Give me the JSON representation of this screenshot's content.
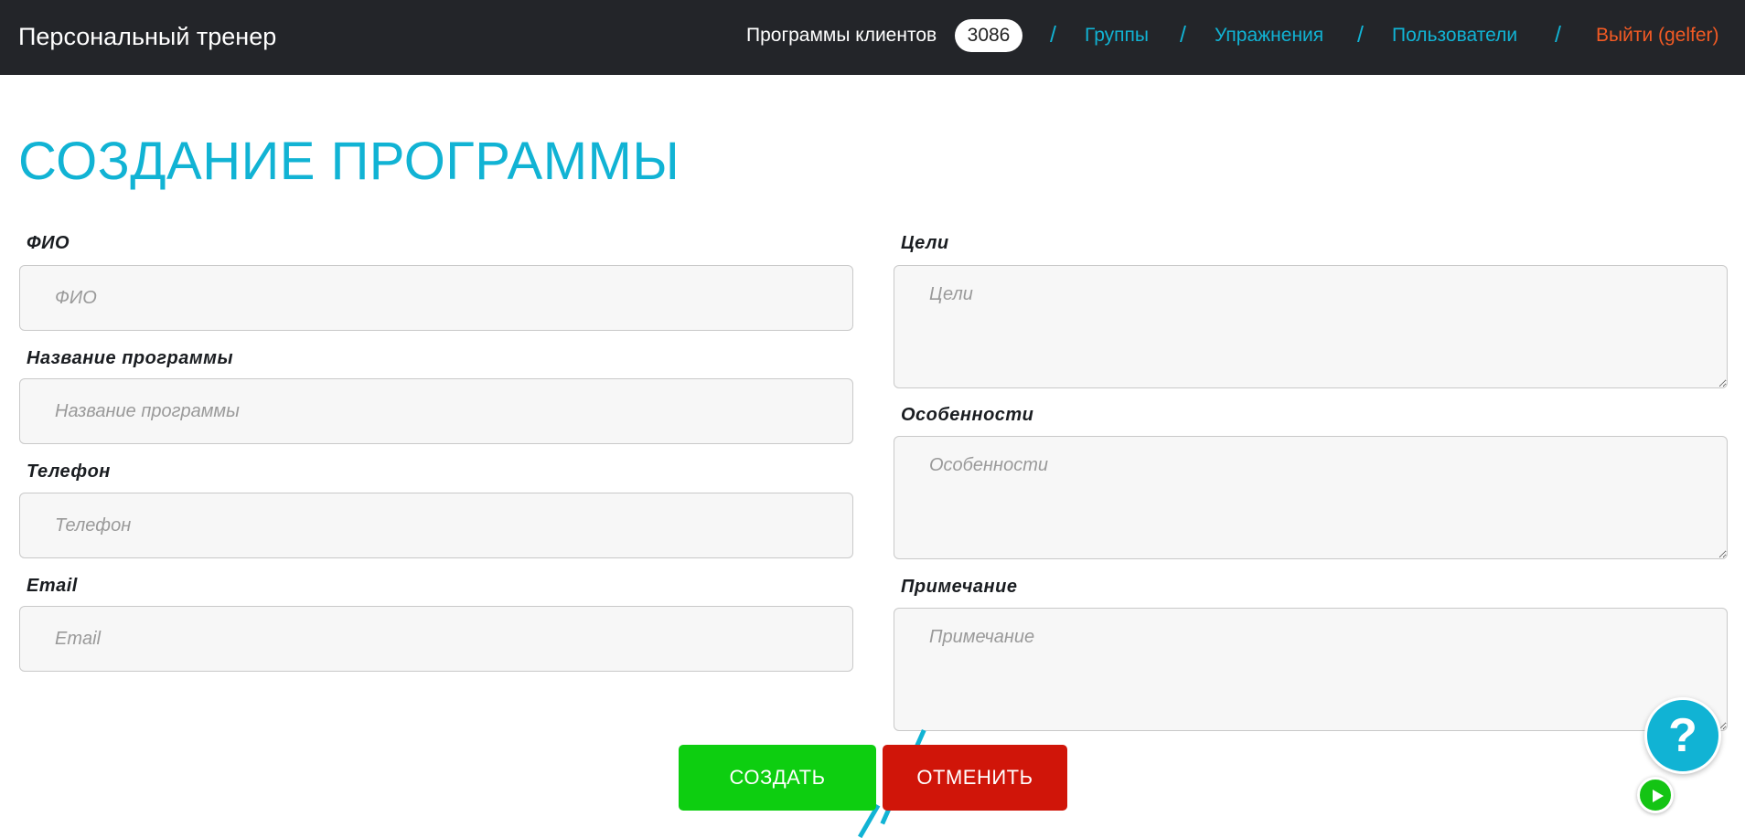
{
  "header": {
    "brand": "Персональный тренер",
    "nav": {
      "programs_label": "Программы клиентов",
      "programs_count": "3086",
      "separator": "/",
      "groups": "Группы",
      "exercises": "Упражнения",
      "users": "Пользователи",
      "logout": "Выйти (gelfer)"
    }
  },
  "page": {
    "title": "СОЗДАНИЕ ПРОГРАММЫ"
  },
  "form": {
    "fio": {
      "label": "ФИО",
      "placeholder": "ФИО",
      "value": ""
    },
    "program_name": {
      "label": "Название программы",
      "placeholder": "Название программы",
      "value": ""
    },
    "phone": {
      "label": "Телефон",
      "placeholder": "Телефон",
      "value": ""
    },
    "email": {
      "label": "Email",
      "placeholder": "Email",
      "value": ""
    },
    "goals": {
      "label": "Цели",
      "placeholder": "Цели",
      "value": ""
    },
    "features": {
      "label": "Особенности",
      "placeholder": "Особенности",
      "value": ""
    },
    "note": {
      "label": "Примечание",
      "placeholder": "Примечание",
      "value": ""
    }
  },
  "actions": {
    "create": "СОЗДАТЬ",
    "cancel": "ОТМЕНИТЬ"
  },
  "help": {
    "symbol": "?",
    "icon": "question-mark-icon",
    "play_icon": "play-icon"
  },
  "colors": {
    "header_bg": "#232529",
    "accent": "#11b3d4",
    "logout": "#f25a24",
    "create": "#0dce10",
    "cancel": "#d01509"
  }
}
